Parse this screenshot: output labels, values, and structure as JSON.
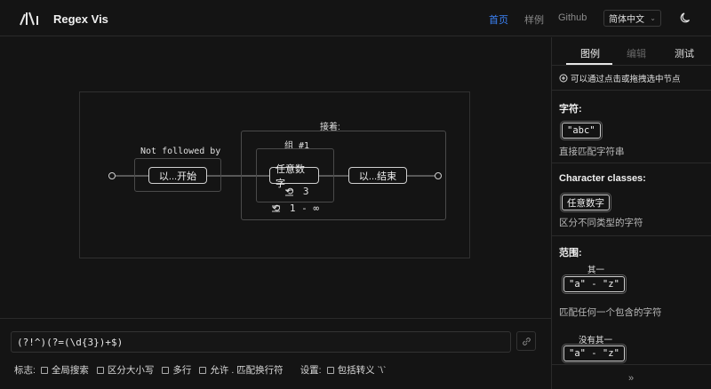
{
  "header": {
    "brand": "Regex Vis",
    "nav": {
      "home": "首页",
      "samples": "样例",
      "github": "Github"
    },
    "language": "简体中文",
    "active_color": "#3b82f6"
  },
  "diagram": {
    "lookahead_label": "接着:",
    "negative_lookahead_label": "Not followed by",
    "group_label": "组 #1",
    "node_start": "以...开始",
    "node_digit": "任意数字",
    "node_end": "以...结束",
    "digit_repeat": "3",
    "group_repeat": "1 - ∞"
  },
  "input": {
    "regex": "(?!^)(?=(\\d{3})+$)",
    "flags_label": "标志:",
    "flags": [
      "全局搜索",
      "区分大小写",
      "多行",
      "允许 . 匹配换行符"
    ],
    "settings_label": "设置:",
    "settings": [
      "包括转义 `\\`"
    ]
  },
  "panel": {
    "tabs": {
      "legend": "图例",
      "edit": "编辑",
      "test": "测试"
    },
    "hint": "可以通过点击或拖拽选中节点",
    "sections": {
      "chars_title": "字符:",
      "chars_example": "\"abc\"",
      "chars_desc": "直接匹配字符串",
      "classes_title": "Character classes:",
      "classes_example": "任意数字",
      "classes_desc": "区分不同类型的字符",
      "range_title": "范围:",
      "range_one_of": "其一",
      "range_example": "\"a\" - \"z\"",
      "range_desc": "匹配任何一个包含的字符",
      "range_none_of": "没有其一",
      "range_example2": "\"a\" - \"z\""
    },
    "expand_icon": "»"
  }
}
